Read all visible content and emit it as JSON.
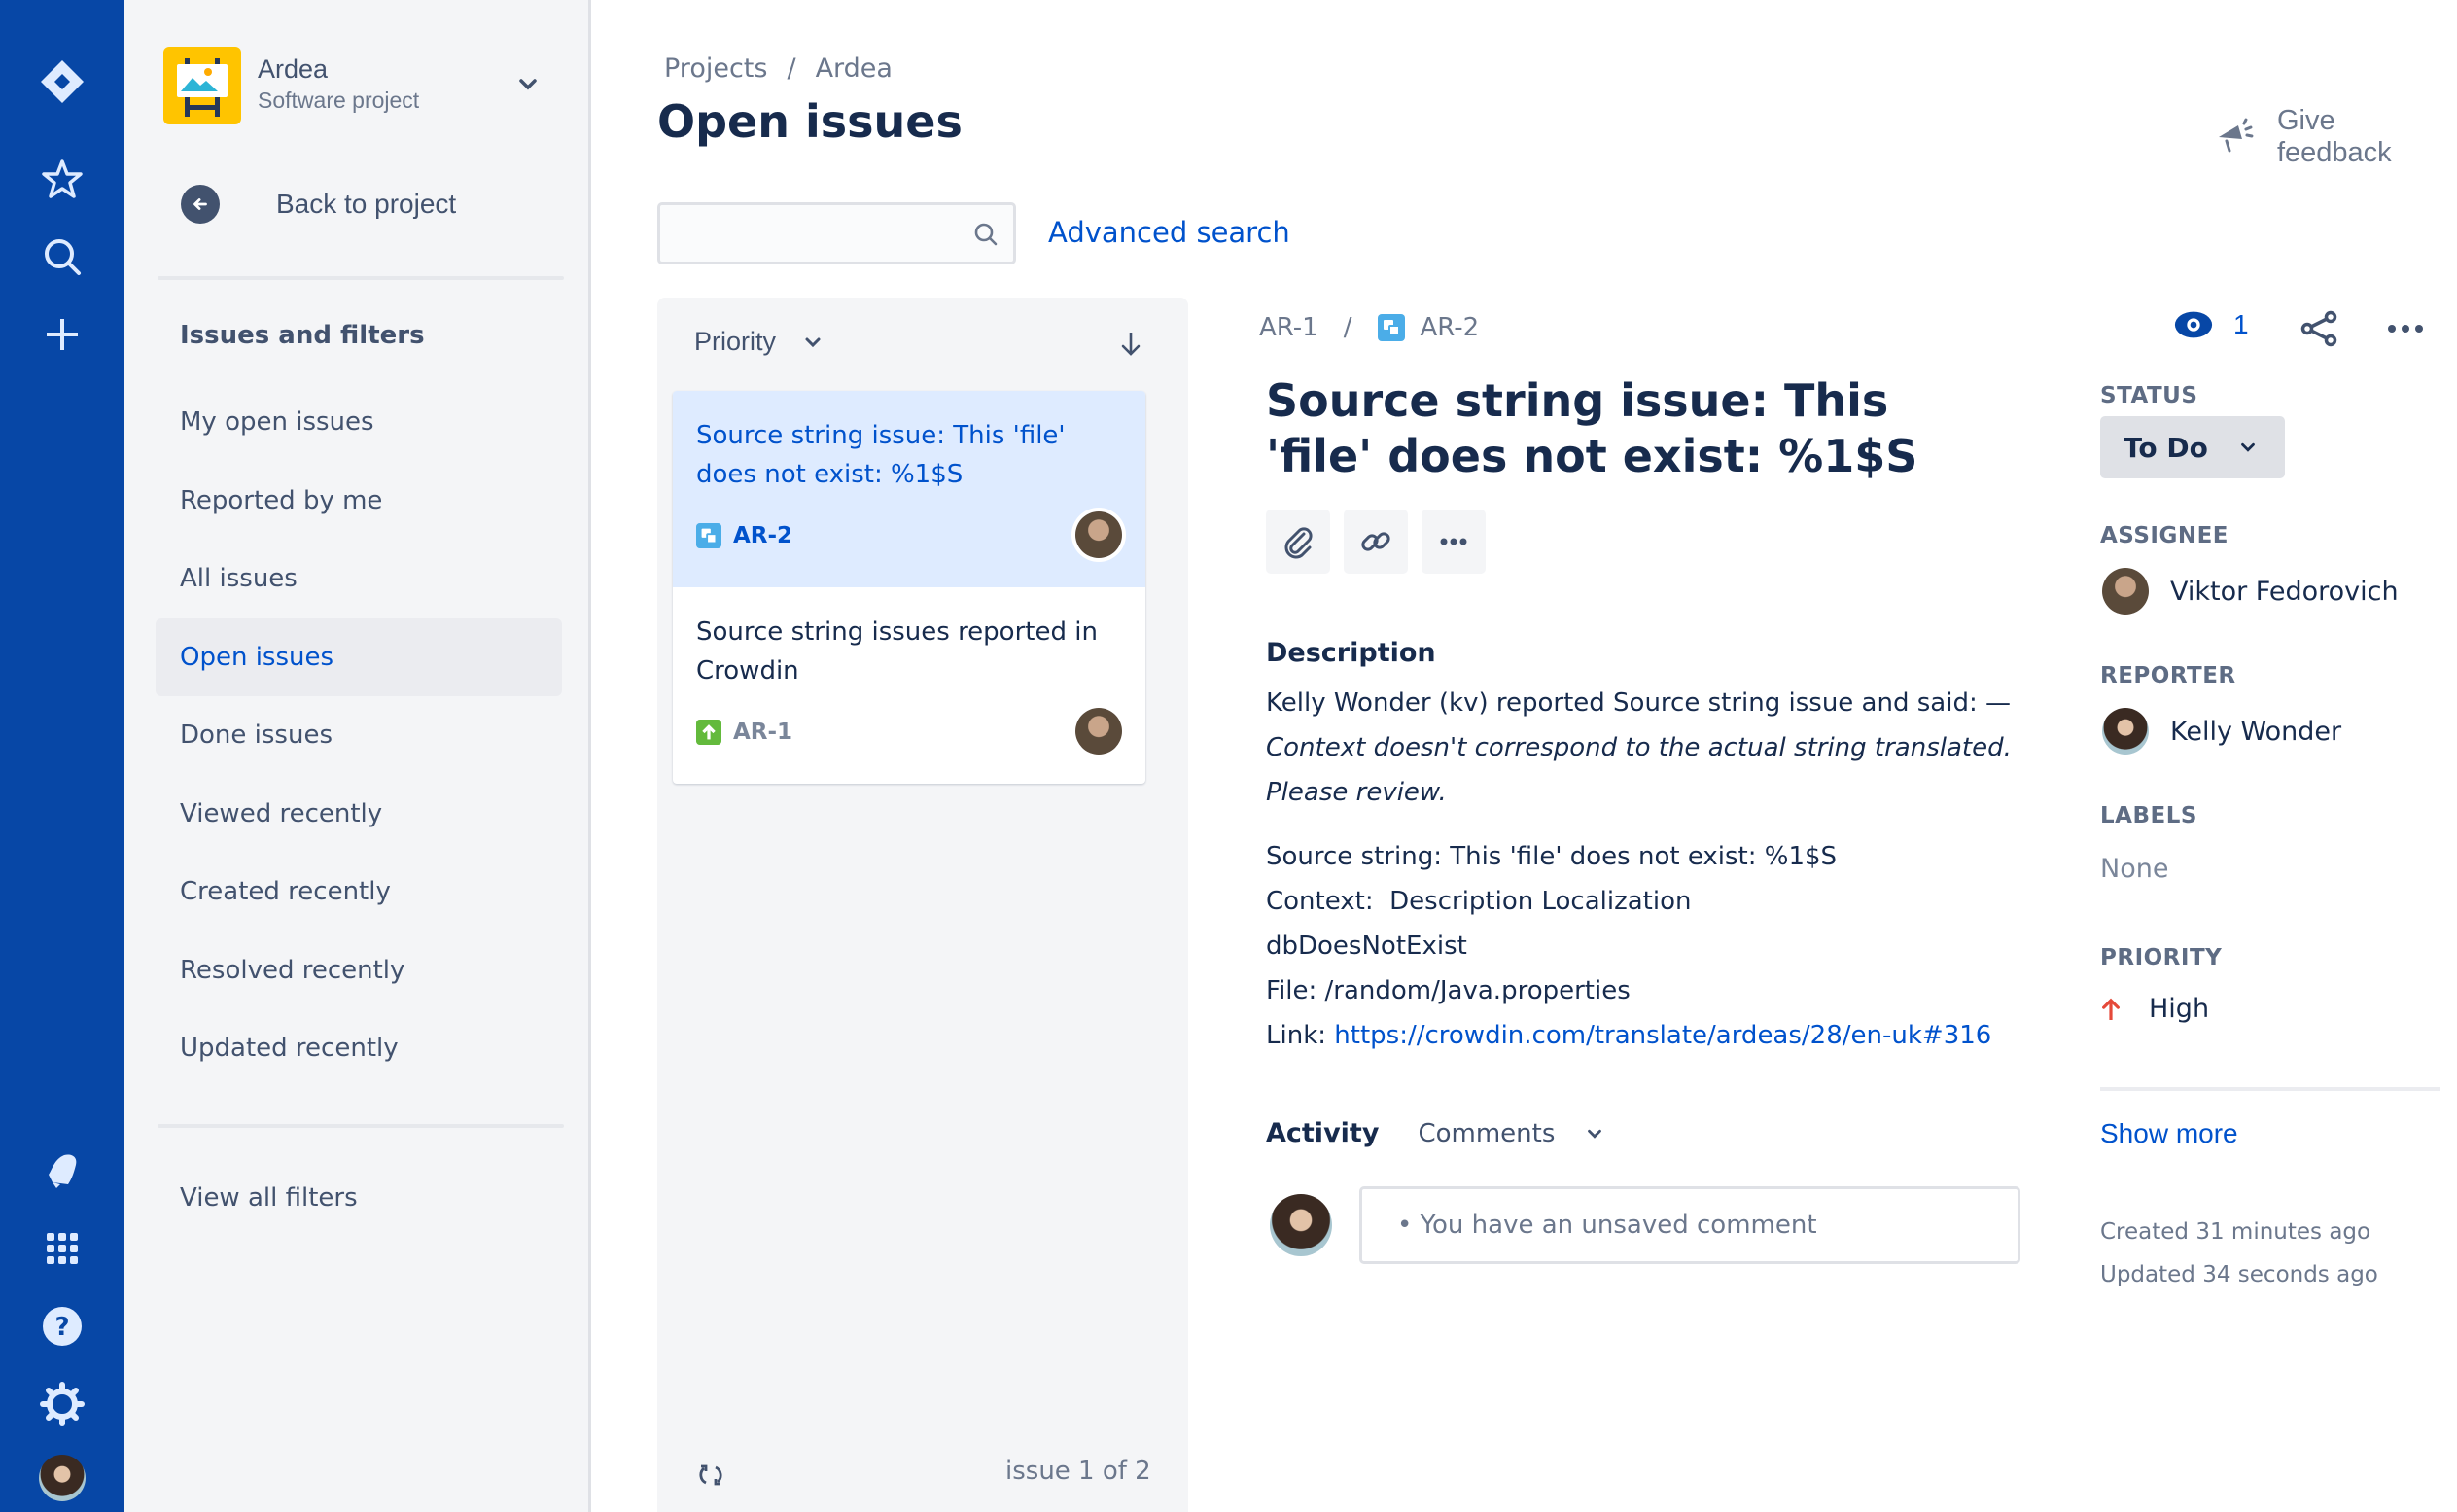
{
  "global_nav": {
    "logo": "jira-logo-icon",
    "top_items": [
      {
        "name": "starred",
        "icon": "star-icon"
      },
      {
        "name": "search",
        "icon": "search-icon"
      },
      {
        "name": "create",
        "icon": "plus-icon"
      }
    ],
    "bottom_items": [
      {
        "name": "notifications",
        "icon": "bell-icon"
      },
      {
        "name": "app-switcher",
        "icon": "grid-icon"
      },
      {
        "name": "help",
        "icon": "help-icon"
      },
      {
        "name": "settings",
        "icon": "gear-icon"
      },
      {
        "name": "profile",
        "icon": "avatar"
      }
    ]
  },
  "project": {
    "name": "Ardea",
    "type": "Software project"
  },
  "sidebar": {
    "back_label": "Back to project",
    "section_heading": "Issues and filters",
    "items": [
      {
        "label": "My open issues",
        "active": false
      },
      {
        "label": "Reported by me",
        "active": false
      },
      {
        "label": "All issues",
        "active": false
      },
      {
        "label": "Open issues",
        "active": true
      },
      {
        "label": "Done issues",
        "active": false
      },
      {
        "label": "Viewed recently",
        "active": false
      },
      {
        "label": "Created recently",
        "active": false
      },
      {
        "label": "Resolved recently",
        "active": false
      },
      {
        "label": "Updated recently",
        "active": false
      }
    ],
    "view_all_filters": "View all filters"
  },
  "header": {
    "breadcrumb": [
      "Projects",
      "Ardea"
    ],
    "breadcrumb_sep": "/",
    "title": "Open issues",
    "give_feedback": "Give feedback",
    "search": {
      "value": "",
      "placeholder": ""
    },
    "advanced_search": "Advanced search"
  },
  "issue_list": {
    "sort_field": "Priority",
    "sort_direction": "descending",
    "issues": [
      {
        "title": "Source string issue: This 'file' does not exist: %1$S",
        "key": "AR-2",
        "type": "subtask",
        "selected": true
      },
      {
        "title": "Source string issues reported in Crowdin",
        "key": "AR-1",
        "type": "story",
        "selected": false
      }
    ],
    "footer_count": "issue 1 of 2"
  },
  "detail": {
    "parent_key": "AR-1",
    "key": "AR-2",
    "title": "Source string issue: This 'file' does not exist: %1$S",
    "watchers": "1",
    "description_label": "Description",
    "description": {
      "intro": "Kelly Wonder (kv) reported Source string issue and said: —",
      "quote_line1": "Context doesn't correspond to the actual string translated.",
      "quote_line2": "Please review.",
      "source_string": "Source string: This 'file' does not exist: %1$S",
      "context": "Context:  Description Localization",
      "identifier": "dbDoesNotExist",
      "file": "File: /random/Java.properties",
      "link_prefix": "Link: ",
      "link_url": "https://crowdin.com/translate/ardeas/28/en-uk#316"
    },
    "activity_label": "Activity",
    "activity_filter": "Comments",
    "comment_placeholder": "• You have an unsaved comment"
  },
  "fields": {
    "status_label": "STATUS",
    "status_value": "To Do",
    "assignee_label": "ASSIGNEE",
    "assignee": "Viktor Fedorovich",
    "reporter_label": "REPORTER",
    "reporter": "Kelly Wonder",
    "labels_label": "LABELS",
    "labels_value": "None",
    "priority_label": "PRIORITY",
    "priority_value": "High",
    "show_more": "Show more",
    "created": "Created 31 minutes ago",
    "updated": "Updated 34 seconds ago"
  },
  "colors": {
    "nav_bg": "#0747a6",
    "accent": "#0052cc",
    "selected_card": "#deebff",
    "priority_high": "#e5493a",
    "subtask_icon": "#4bade8",
    "story_icon": "#63ba3c"
  }
}
